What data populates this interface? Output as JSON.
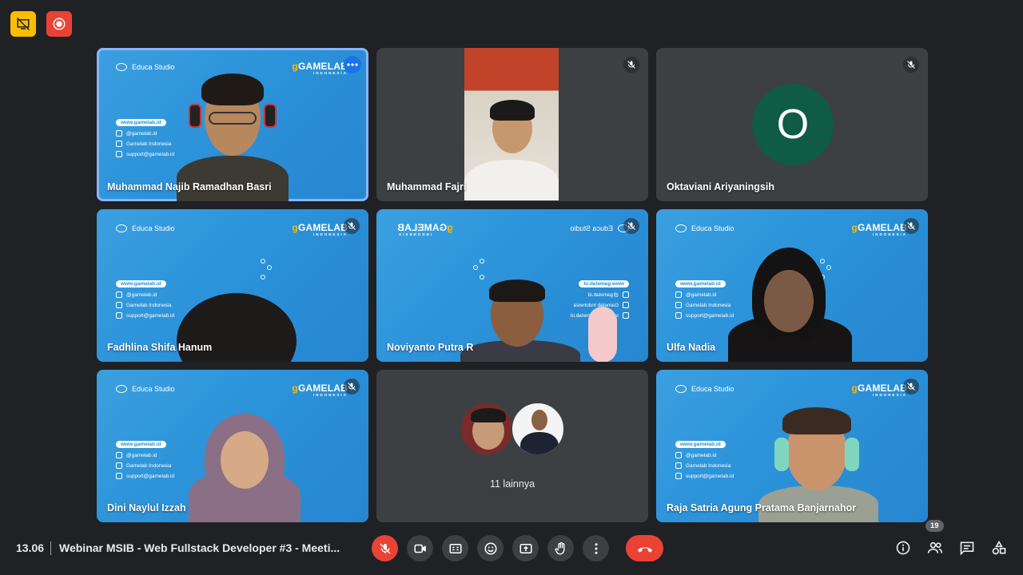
{
  "indicators": [
    {
      "name": "presentation-off",
      "color": "#fbbc04"
    },
    {
      "name": "recording",
      "color": "#ea4335"
    }
  ],
  "banner": {
    "educa": "Educa Studio",
    "gamelab": "GAMELAB",
    "gamelab_sub": "INDONESIA",
    "website": "www.gamelab.id",
    "instagram": "@gamelab.id",
    "facebook": "Gamelab Indonesia",
    "email": "support@gamelab.id"
  },
  "participants": [
    {
      "name": "Muhammad Najib Ramadhan Basri",
      "active": true,
      "muted": false
    },
    {
      "name": "Muhammad Fajri",
      "muted": true
    },
    {
      "name": "Oktaviani Ariyaningsih",
      "muted": true,
      "avatar_letter": "O",
      "avatar_color": "#0f5b45"
    },
    {
      "name": "Fadhlina Shifa Hanum",
      "muted": true
    },
    {
      "name": "Noviyanto Putra R",
      "muted": true
    },
    {
      "name": "Ulfa Nadia",
      "muted": true
    },
    {
      "name": "Dini Naylul Izzah",
      "muted": true
    },
    {
      "name": "",
      "others_label": "11 lainnya"
    },
    {
      "name": "Raja Satria Agung Pratama Banjarnahor",
      "muted": true
    }
  ],
  "bottom_bar": {
    "time": "13.06",
    "meeting_title": "Webinar MSIB - Web Fullstack Developer #3 - Meeti...",
    "participant_count": "19",
    "controls": [
      "mic-off",
      "camera",
      "captions",
      "reactions",
      "present",
      "raise-hand",
      "more-options",
      "leave-call"
    ],
    "right_controls": [
      "meeting-details",
      "people",
      "chat",
      "activities"
    ]
  }
}
